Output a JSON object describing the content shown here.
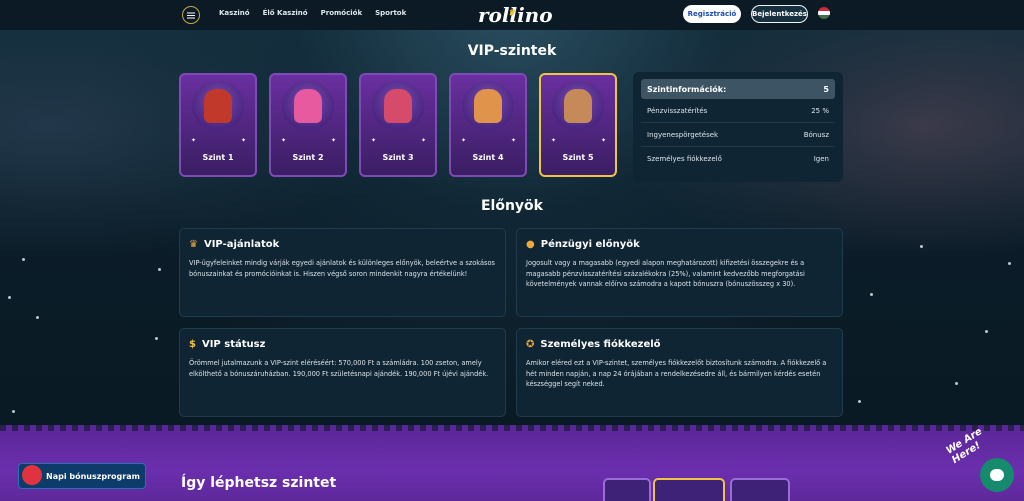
{
  "header": {
    "menu_icon": "hamburger-icon",
    "nav": [
      "Kaszinó",
      "Élő Kaszinó",
      "Promóciók",
      "Sportok"
    ],
    "logo": "rollino",
    "register": "Regisztráció",
    "login": "Bejelentkezés",
    "language_flag": "hu-flag-icon"
  },
  "vip": {
    "title": "VIP-szintek",
    "levels": [
      {
        "label": "Szint 1"
      },
      {
        "label": "Szint 2"
      },
      {
        "label": "Szint 3"
      },
      {
        "label": "Szint 4"
      },
      {
        "label": "Szint 5"
      }
    ],
    "info": {
      "head_label": "Szintinformációk:",
      "head_value": "5",
      "rows": [
        {
          "label": "Pénzvisszatérítés",
          "value": "25 %"
        },
        {
          "label": "Ingyenespörgetések",
          "value": "Bónusz"
        },
        {
          "label": "Személyes fiókkezelő",
          "value": "Igen"
        }
      ]
    }
  },
  "benefits": {
    "title": "Előnyök",
    "cards": [
      {
        "icon": "crown-icon",
        "title": "VIP-ajánlatok",
        "text": "VIP-ügyfeleinket mindig várják egyedi ajánlatok és különleges előnyök, beleértve a szokásos bónuszainkat és promócióinkat is. Hiszen végső soron mindenkit nagyra értékelünk!"
      },
      {
        "icon": "coin-icon",
        "title": "Pénzügyi előnyök",
        "text": "Jogosult vagy a magasabb (egyedi alapon meghatározott) kifizetési összegekre és a magasabb pénzvisszatérítési százalékokra (25%), valamint kedvezőbb megforgatási követelmények vannak előírva számodra a kapott bónuszra (bónuszösszeg x 30)."
      },
      {
        "icon": "dollar-icon",
        "title": "VIP státusz",
        "text": "Örömmel jutalmazunk a VIP-szint eléréséért: 570,000 Ft a számládra. 100 zseton, amely elkölthető a bónuszáruházban. 190,000 Ft születésnapi ajándék. 190,000 Ft újévi ajándék."
      },
      {
        "icon": "medal-icon",
        "title": "Személyes fiókkezelő",
        "text": "Amikor eléred ezt a VIP-szintet, személyes fiókkezelőt biztosítunk számodra. A fiókkezelő a hét minden napján, a nap 24 órájában a rendelkezésedre áll, és bármilyen kérdés esetén készséggel segít neked."
      }
    ]
  },
  "bottom": {
    "bonus_button": "Napi bónuszprogram",
    "steps_title": "Így léphetsz szintet",
    "chat_label": "We Are Here!",
    "chat_icon": "chat-icon"
  },
  "colors": {
    "accent_gold": "#f0c245",
    "card_purple": "#6a2fa0",
    "panel": "#0f2534",
    "band": "#6b2fae"
  }
}
